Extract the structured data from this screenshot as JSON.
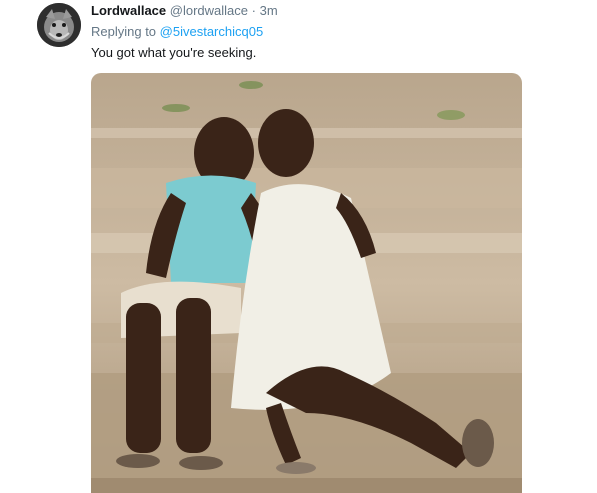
{
  "tweet": {
    "display_name": "Lordwallace",
    "handle": "@lordwallace",
    "separator": "·",
    "time": "3m",
    "replying_prefix": "Replying to",
    "replying_handle": "@5ivestarchicq05",
    "text": "You got what you're seeking.",
    "media_description_icon": "photo-icon"
  },
  "colors": {
    "name": "#14171a",
    "muted": "#657786",
    "link": "#1da1f2"
  }
}
